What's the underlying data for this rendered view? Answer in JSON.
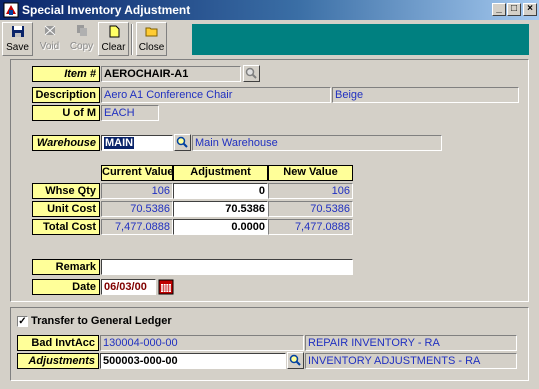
{
  "window": {
    "title": "Special Inventory Adjustment",
    "min_glyph": "_",
    "max_glyph": "□",
    "close_glyph": "×"
  },
  "toolbar": {
    "save": "Save",
    "void": "Void",
    "copy": "Copy",
    "clear": "Clear",
    "close": "Close"
  },
  "item": {
    "label": "Item #",
    "value": "AEROCHAIR-A1",
    "description_label": "Description",
    "description": "Aero A1 Conference Chair",
    "color": "Beige",
    "uom_label": "U of M",
    "uom": "EACH"
  },
  "warehouse": {
    "label": "Warehouse",
    "code": "MAIN",
    "name": "Main Warehouse"
  },
  "grid": {
    "headers": [
      "Current Value",
      "Adjustment",
      "New Value"
    ],
    "rows": [
      {
        "label": "Whse Qty",
        "current": "106",
        "adjustment": "0",
        "new": "106"
      },
      {
        "label": "Unit Cost",
        "current": "70.5386",
        "adjustment": "70.5386",
        "new": "70.5386"
      },
      {
        "label": "Total Cost",
        "current": "7,477.0888",
        "adjustment": "0.0000",
        "new": "7,477.0888"
      }
    ]
  },
  "remark": {
    "label": "Remark",
    "value": ""
  },
  "date": {
    "label": "Date",
    "value": "06/03/00"
  },
  "gl": {
    "checkbox_label": "Transfer to General Ledger",
    "checked_glyph": "✓",
    "bad_label": "Bad InvtAcc",
    "bad_account": "130004-000-00",
    "bad_account_name": "REPAIR INVENTORY - RA",
    "adj_label": "Adjustments",
    "adj_account": "500003-000-00",
    "adj_account_name": "INVENTORY ADJUSTMENTS - RA"
  },
  "colors": {
    "label_bg": "#ffff99",
    "toolbar_fill": "#008080",
    "value_text": "#2030c0",
    "title_bar": "#0a246a"
  }
}
